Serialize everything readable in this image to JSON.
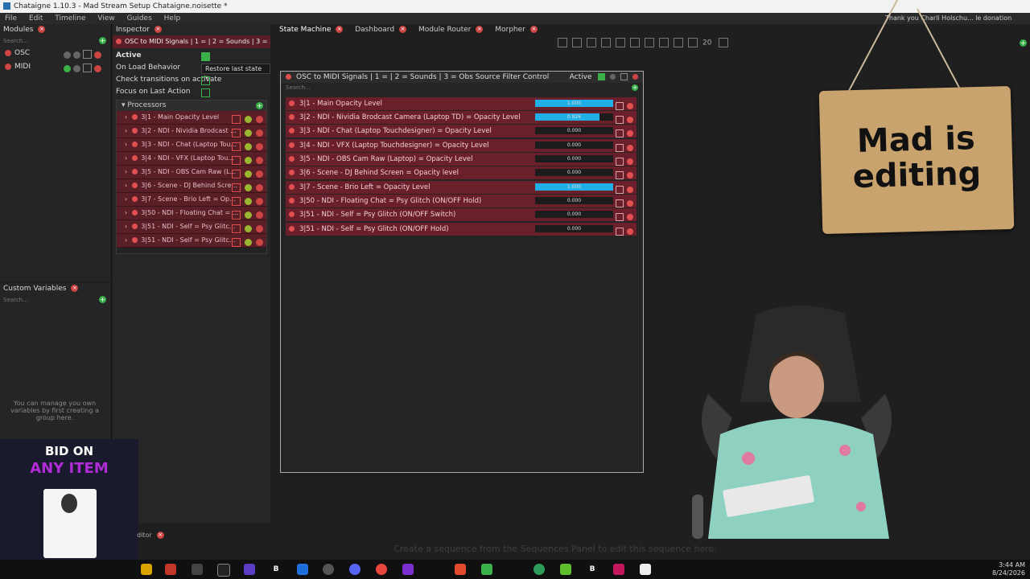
{
  "window": {
    "title": "Chataigne 1.10.3 - Mad Stream Setup Chataigne.noisette *"
  },
  "menu": [
    "File",
    "Edit",
    "Timeline",
    "View",
    "Guides",
    "Help"
  ],
  "ticker": "Thank you Charli Holschu... le donation",
  "modules": {
    "title": "Modules",
    "search_placeholder": "Search...",
    "items": [
      {
        "label": "OSC"
      },
      {
        "label": "MIDI"
      }
    ]
  },
  "custom_variables": {
    "title": "Custom Variables",
    "search_placeholder": "Search...",
    "hint": "You can manage you own variables by first creating a group here."
  },
  "inspector": {
    "title": "Inspector",
    "header": "OSC to MIDI Signals | 1 = | 2 = Sounds | 3 = ...",
    "active_label": "Active",
    "on_load_label": "On Load Behavior",
    "on_load_value": "Restore last state",
    "check_transitions_label": "Check transitions on activate",
    "focus_label": "Focus on Last Action",
    "processors_label": "Processors",
    "processors": [
      "3|1 - Main Opacity Level",
      "3|2 - NDI - Nividia Brodcast ...",
      "3|3 - NDI - Chat (Laptop Tou...",
      "3|4 - NDI - VFX (Laptop Tou...",
      "3|5 - NDI - OBS Cam Raw (L...",
      "3|6 - Scene - DJ Behind Scre...",
      "3|7 - Scene - Brio Left = Op...",
      "3|50 - NDI - Floating Chat = ...",
      "3|51 - NDI - Self = Psy Glitc...",
      "3|51 - NDI - Self = Psy Glitc..."
    ]
  },
  "tabs": [
    {
      "label": "State Machine",
      "active": true
    },
    {
      "label": "Dashboard",
      "active": false
    },
    {
      "label": "Module Router",
      "active": false
    },
    {
      "label": "Morpher",
      "active": false
    }
  ],
  "toolbar": {
    "zoom_value": "20"
  },
  "state_window": {
    "title": "OSC to MIDI Signals | 1 = | 2 = Sounds | 3 = Obs Source Filter Control",
    "active_label": "Active",
    "search_placeholder": "Search...",
    "rows": [
      {
        "label": "3|1 - Main Opacity Level",
        "value": 1.0,
        "value_text": "1.000"
      },
      {
        "label": "3|2 - NDI - Nividia Brodcast Camera (Laptop TD) = Opacity Level",
        "value": 0.826,
        "value_text": "0.826"
      },
      {
        "label": "3|3 - NDI - Chat (Laptop Touchdesigner) = Opacity Level",
        "value": 0,
        "value_text": "0.000"
      },
      {
        "label": "3|4 - NDI - VFX (Laptop Touchdesigner) = Opacity Level",
        "value": 0,
        "value_text": "0.000"
      },
      {
        "label": "3|5 - NDI - OBS Cam Raw (Laptop) = Opacity Level",
        "value": 0,
        "value_text": "0.000"
      },
      {
        "label": "3|6 - Scene - DJ Behind Screen = Opacity level",
        "value": 0,
        "value_text": "0.000"
      },
      {
        "label": "3|7 - Scene - Brio Left = Opacity Level",
        "value": 1.0,
        "value_text": "1.000"
      },
      {
        "label": "3|50 - NDI - Floating Chat = Psy Glitch (ON/OFF Hold)",
        "value": 0,
        "value_text": "0.000"
      },
      {
        "label": "3|51 - NDI - Self = Psy Glitch (ON/OFF Switch)",
        "value": 0,
        "value_text": "0.000"
      },
      {
        "label": "3|51 - NDI - Self = Psy Glitch (ON/OFF Hold)",
        "value": 0,
        "value_text": "0.000"
      }
    ]
  },
  "overlay_sign": {
    "text": "Mad is editing"
  },
  "promo": {
    "line1": "BID ON",
    "line2": "ANY ITEM"
  },
  "sequence_hint": "Create a sequence from the Sequences Panel to edit this sequence here.",
  "editor_label": "ditor",
  "clock": {
    "time": "3:44 AM",
    "date": "8/24/2026"
  },
  "colors": {
    "accent": "#21b0e6",
    "row": "#6b1f2b",
    "active_green": "#3bb14a",
    "close_red": "#cc4444"
  }
}
